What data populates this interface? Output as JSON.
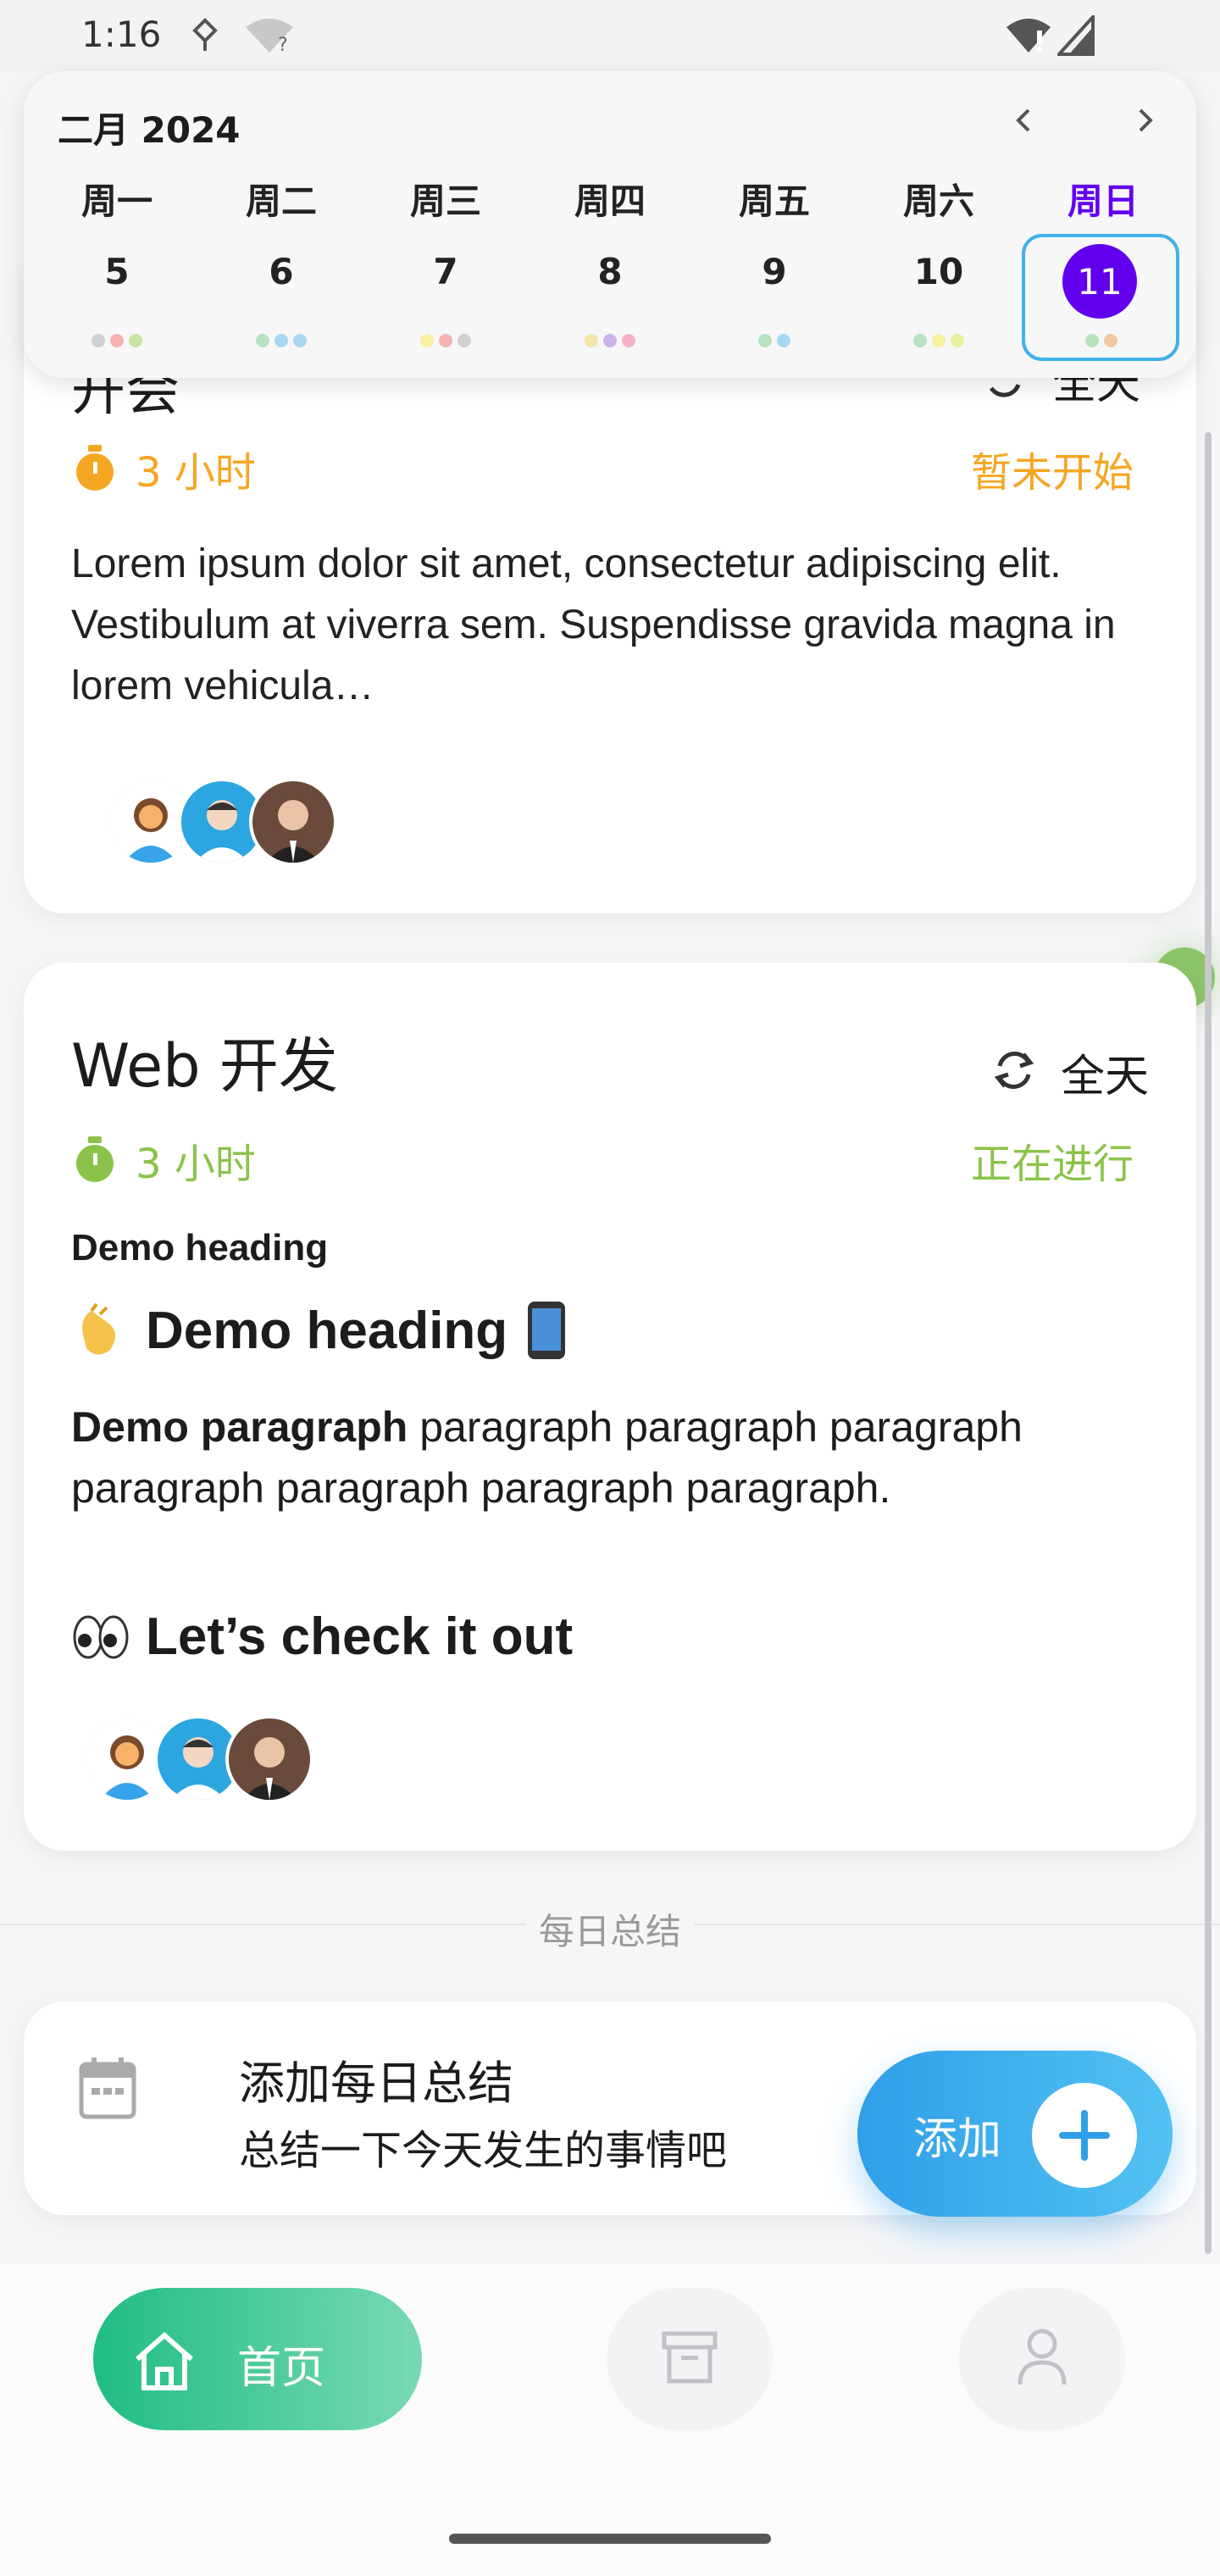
{
  "status_bar": {
    "time": "1:16"
  },
  "calendar": {
    "month_label": "二月 2024",
    "weekdays": [
      "周一",
      "周二",
      "周三",
      "周四",
      "周五",
      "周六",
      "周日"
    ],
    "days": [
      "5",
      "6",
      "7",
      "8",
      "9",
      "10",
      "11"
    ],
    "selected_day": "11",
    "accent": "#6200ee",
    "selection_border": "#3fb1ea"
  },
  "card1": {
    "title": "开会",
    "repeat_label": "全天",
    "duration": "3 小时",
    "status": "暂未开始",
    "status_color": "#f5a623",
    "description": "Lorem ipsum dolor sit amet, consectetur adipiscing elit. Vestibulum at viverra sem. Suspendisse gravida magna in lorem vehicula…"
  },
  "card2": {
    "title": "Web 开发",
    "repeat_label": "全天",
    "duration": "3 小时",
    "status": "正在进行",
    "status_color": "#8bc34a",
    "demo_heading_small": "Demo heading",
    "demo_heading_big": "Demo heading",
    "demo_paragraph_bold": "Demo paragraph",
    "demo_paragraph_rest": "paragraph paragraph paragraph paragraph paragraph paragraph paragraph.",
    "check_it_out": "Let’s check it out"
  },
  "daily_summary": {
    "section_label": "每日总结",
    "title": "添加每日总结",
    "subtitle": "总结一下今天发生的事情吧",
    "add_label": "添加"
  },
  "bottom_nav": {
    "home_label": "首页"
  }
}
